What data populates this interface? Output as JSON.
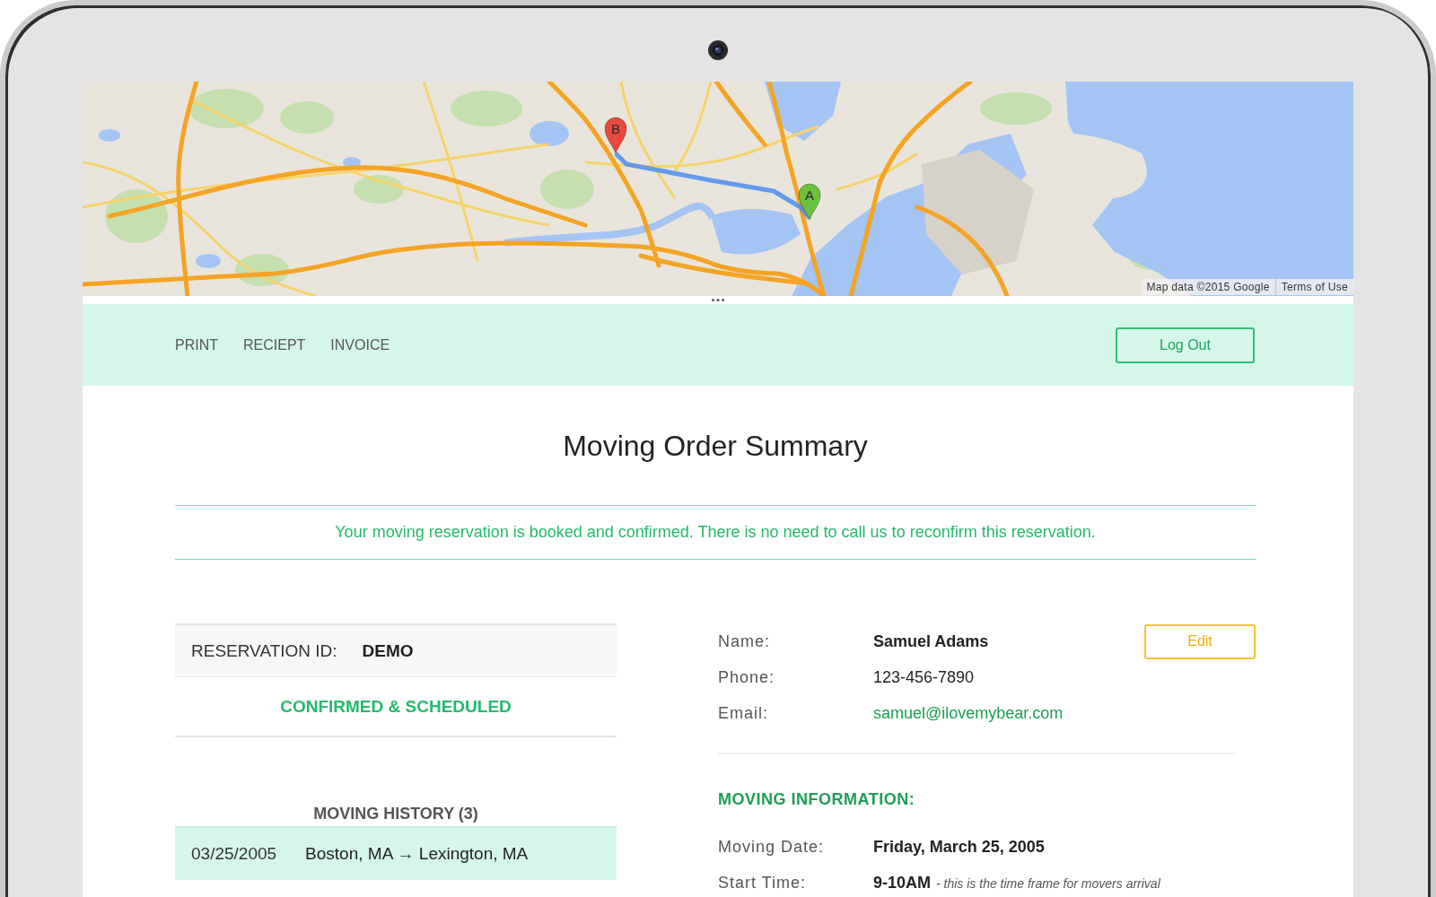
{
  "map": {
    "markers": [
      {
        "label": "B",
        "color": "#ea4a3c"
      },
      {
        "label": "A",
        "color": "#6cc13f"
      }
    ],
    "attribution": "Map data ©2015 Google",
    "terms_link": "Terms of Use"
  },
  "nav": {
    "links": [
      "PRINT",
      "RECIEPT",
      "INVOICE"
    ],
    "logout_button": "Log Out"
  },
  "page": {
    "title": "Moving Order Summary",
    "notice": "Your moving reservation is booked and confirmed. There is no need to call us to reconfirm this reservation."
  },
  "reservation": {
    "id_label": "RESERVATION ID:",
    "id_value": "DEMO",
    "status": "CONFIRMED & SCHEDULED"
  },
  "history": {
    "title": "MOVING HISTORY (3)",
    "rows": [
      {
        "date": "03/25/2005",
        "route": "Boston, MA → Lexington, MA"
      }
    ]
  },
  "contact": {
    "fields": [
      {
        "label": "Name:",
        "value": "Samuel Adams",
        "kind": "bold"
      },
      {
        "label": "Phone:",
        "value": "123-456-7890",
        "kind": "plain"
      },
      {
        "label": "Email:",
        "value": "samuel@ilovemybear.com",
        "kind": "link"
      }
    ],
    "edit_button": "Edit"
  },
  "moving_info": {
    "title": "MOVING INFORMATION:",
    "fields": [
      {
        "label": "Moving Date:",
        "value": "Friday, March 25, 2005"
      },
      {
        "label": "Start Time:",
        "value": "9-10AM",
        "note": "- this is the time frame for movers arrival"
      }
    ]
  }
}
